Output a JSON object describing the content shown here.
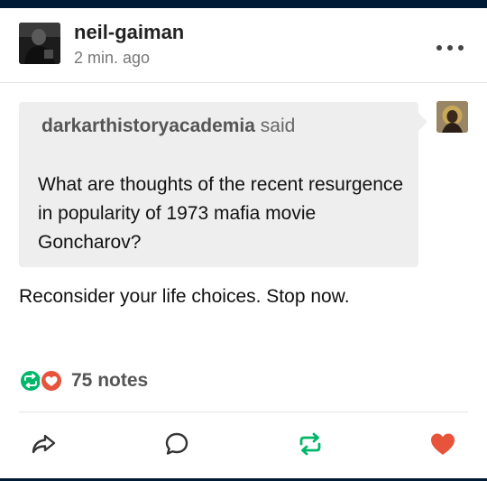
{
  "post": {
    "username": "neil-gaiman",
    "timestamp": "2 min. ago"
  },
  "ask": {
    "asker": "darkarthistoryacademia",
    "said": "said",
    "question": "What are thoughts of the recent resurgence in popularity of 1973 mafia movie Goncharov?"
  },
  "answer": "Reconsider your life choices. Stop now.",
  "notes": {
    "count_label": "75 notes"
  },
  "actions": [
    {
      "name": "share",
      "icon": "share-arrow-icon"
    },
    {
      "name": "reply",
      "icon": "speech-bubble-icon"
    },
    {
      "name": "reblog",
      "icon": "reblog-icon"
    },
    {
      "name": "like",
      "icon": "heart-icon"
    }
  ],
  "colors": {
    "top_bar": "#001935",
    "reblog": "#00b76a",
    "like": "#e8533c",
    "ask_background": "#eeeeee"
  }
}
